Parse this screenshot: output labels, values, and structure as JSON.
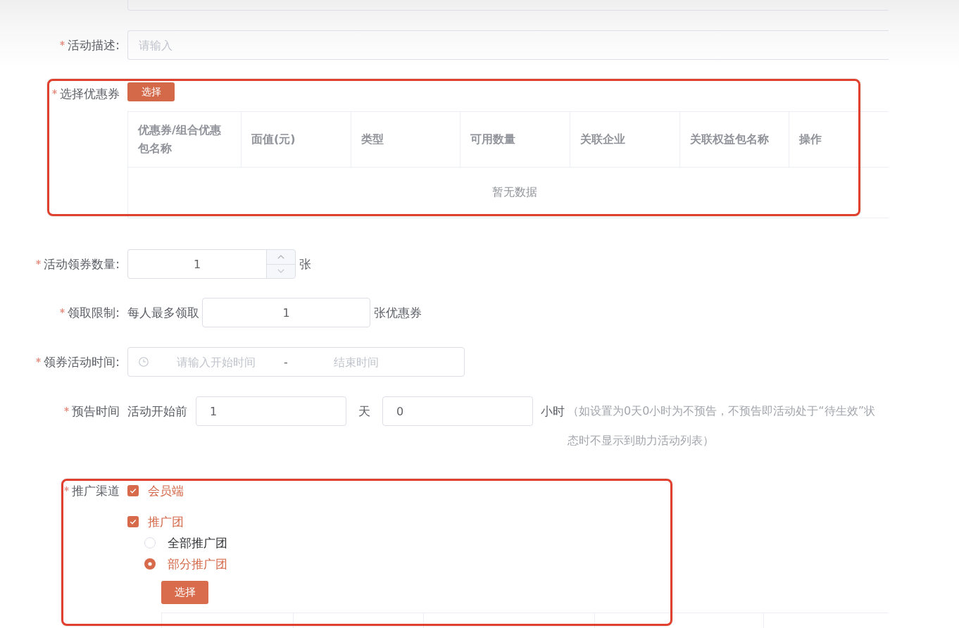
{
  "items": [
    {
      "kind": "cut_field"
    },
    {
      "kind": "input",
      "label": "活动描述:",
      "required": true,
      "placeholder": "请输入"
    },
    {
      "kind": "coupon_table",
      "label": "选择优惠券",
      "required": true,
      "highlighted": true,
      "button": "选择",
      "columns": [
        "优惠券/组合优惠包名称",
        "面值(元)",
        "类型",
        "可用数量",
        "关联企业",
        "关联权益包名称",
        "操作"
      ],
      "empty_text": "暂无数据"
    },
    {
      "kind": "number",
      "label": "活动领券数量:",
      "required": true,
      "value": "1",
      "suffix": "张"
    },
    {
      "kind": "limit",
      "label": "领取限制:",
      "required": true,
      "prefix": "每人最多领取",
      "value": "1",
      "suffix": "张优惠券"
    },
    {
      "kind": "date_range",
      "label": "领券活动时间:",
      "required": true,
      "start_placeholder": "请输入开始时间",
      "separator": "-",
      "end_placeholder": "结束时间"
    },
    {
      "kind": "notice",
      "label": "预告时间",
      "required": true,
      "prefix": "活动开始前",
      "days": "1",
      "days_unit": "天",
      "hours": "0",
      "hours_unit": "小时",
      "hint": "（如设置为0天0小时为不预告，不预告即活动处于“待生效”状态时不显示到助力活动列表）"
    },
    {
      "kind": "channels",
      "label": "推广渠道",
      "required": true,
      "highlighted": true,
      "options": [
        {
          "label": "会员端",
          "checked": true
        },
        {
          "label": "推广团",
          "checked": true,
          "scope": [
            {
              "label": "全部推广团",
              "selected": false
            },
            {
              "label": "部分推广团",
              "selected": true
            }
          ],
          "button": "选择"
        }
      ]
    }
  ]
}
